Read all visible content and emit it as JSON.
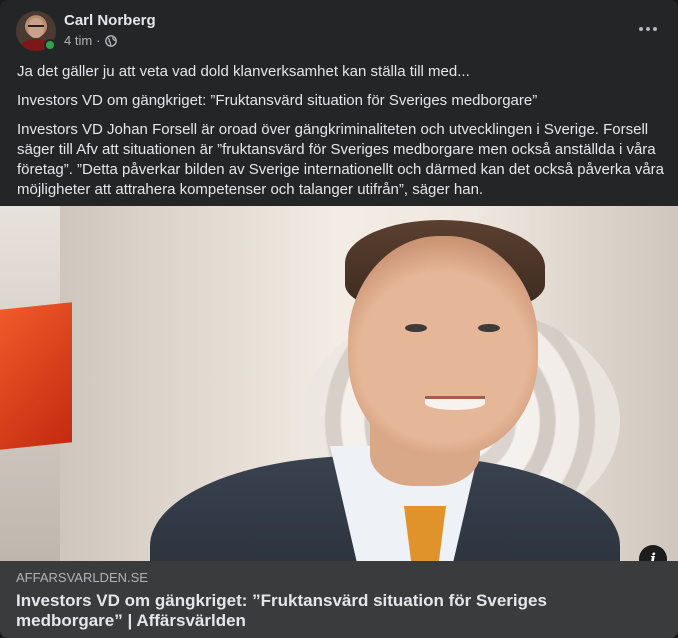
{
  "post": {
    "author_name": "Carl Norberg",
    "time_ago": "4 tim",
    "separator": "·",
    "privacy_icon": "globe-icon",
    "more_icon": "more-horizontal-icon",
    "online": true,
    "paragraphs": [
      "Ja det gäller ju att veta vad dold klanverksamhet kan ställa till med...",
      "Investors VD om gängkriget: ”Fruktansvärd situation för Sveriges medborgare”",
      "Investors VD Johan Forsell är oroad över gängkriminaliteten och utvecklingen i Sverige. Forsell säger till Afv att situationen är ”fruktansvärd för Sveriges medborgare men också anställda i våra företag”. ”Detta påverkar bilden av Sverige internationellt och därmed kan det också påverka våra möjligheter att attrahera kompetenser och talanger utifrån”, säger han."
    ],
    "info_icon": "info-icon",
    "info_glyph": "i"
  },
  "link_preview": {
    "domain": "AFFARSVARLDEN.SE",
    "title": "Investors VD om gängkriget: ”Fruktansvärd situation för Sveriges medborgare” | Affärsvärlden"
  },
  "colors": {
    "card_bg": "#242526",
    "preview_bg": "#3a3b3c",
    "primary_text": "#e4e6eb",
    "secondary_text": "#b0b3b8",
    "online_green": "#31a24c"
  }
}
